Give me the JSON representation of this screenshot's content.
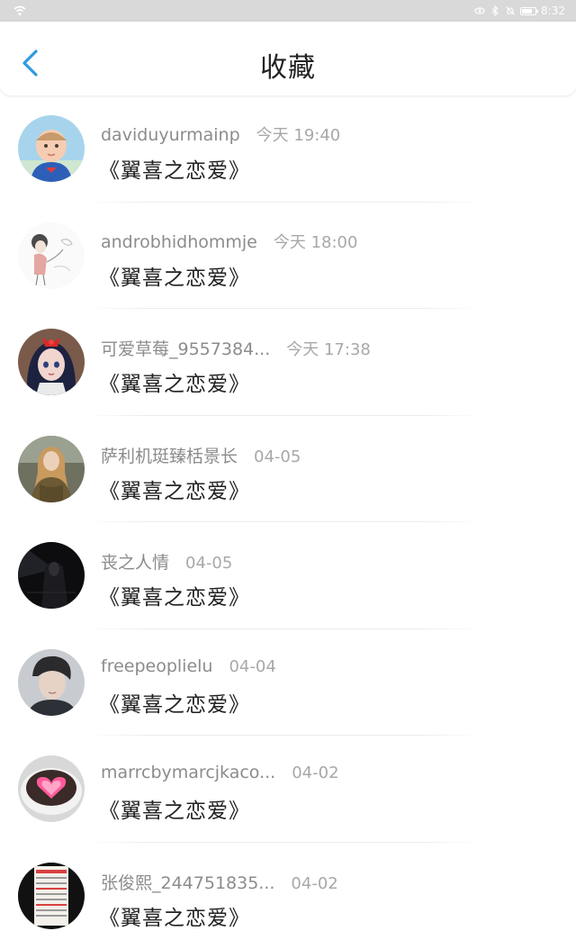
{
  "status_bar": {
    "time": "8:32",
    "icons": [
      "wifi-icon",
      "eye-icon",
      "bluetooth-icon",
      "mute-icon",
      "battery-icon"
    ]
  },
  "header": {
    "back_icon": "chevron-left-icon",
    "title": "收藏"
  },
  "colors": {
    "accent": "#2f9be0",
    "status_bar_bg": "#d9d9d9",
    "title_text": "#222222",
    "meta_text": "#8c8c8c"
  },
  "favorites": [
    {
      "user": "daviduyurmainp",
      "time": "今天 19:40",
      "title": "《翼喜之恋爱》",
      "avatar": "baby-avatar"
    },
    {
      "user": "androbhidhommje",
      "time": "今天 18:00",
      "title": "《翼喜之恋爱》",
      "avatar": "sketch-girl-avatar"
    },
    {
      "user": "可爱草莓_9557384...",
      "time": "今天 17:38",
      "title": "《翼喜之恋爱》",
      "avatar": "anime-girl-avatar"
    },
    {
      "user": "萨利机珽臻栝景长",
      "time": "04-05",
      "title": "《翼喜之恋爱》",
      "avatar": "woman-photo-avatar"
    },
    {
      "user": "丧之人情",
      "time": "04-05",
      "title": "《翼喜之恋爱》",
      "avatar": "dark-figure-avatar"
    },
    {
      "user": "freepeoplielu",
      "time": "04-04",
      "title": "《翼喜之恋爱》",
      "avatar": "man-portrait-avatar"
    },
    {
      "user": "marrcbymarcjkaco...",
      "time": "04-02",
      "title": "《翼喜之恋爱》",
      "avatar": "heart-latte-avatar"
    },
    {
      "user": "张俊熙_244751835...",
      "time": "04-02",
      "title": "《翼喜之恋爱》",
      "avatar": "menu-board-avatar"
    }
  ]
}
